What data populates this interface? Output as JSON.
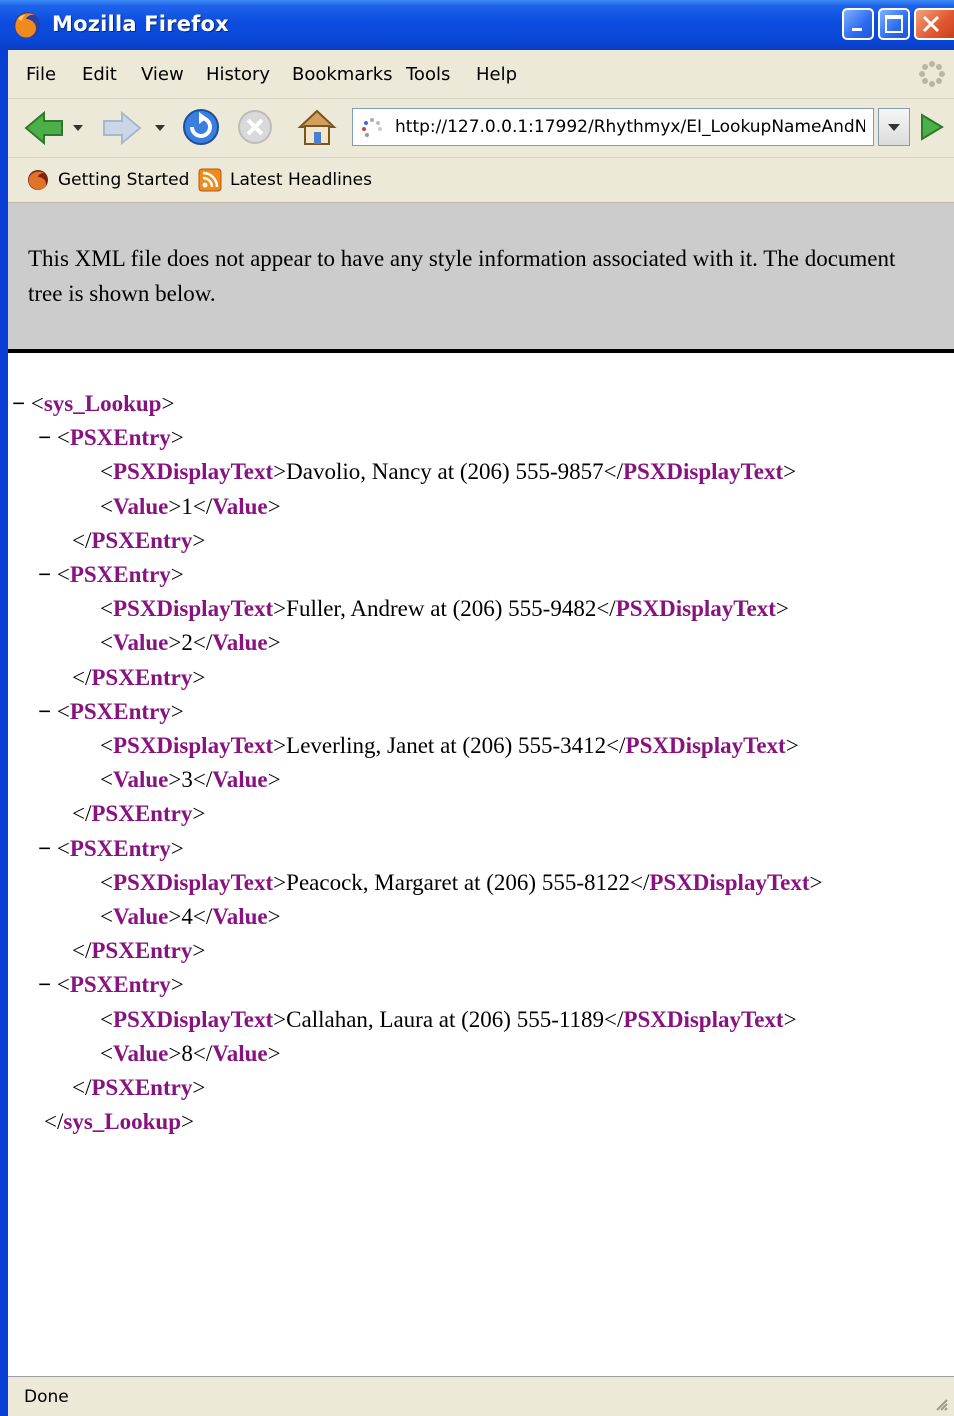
{
  "window": {
    "title": "Mozilla Firefox"
  },
  "menu": [
    "File",
    "Edit",
    "View",
    "History",
    "Bookmarks",
    "Tools",
    "Help"
  ],
  "address": {
    "url": "http://127.0.0.1:17992/Rhythmyx/EI_LookupNameAndNu"
  },
  "bookmarks": [
    "Getting Started",
    "Latest Headlines"
  ],
  "notice": "This XML file does not appear to have any style information associated with it. The document tree is shown below.",
  "xml": {
    "root_tag": "sys_Lookup",
    "entry_tag": "PSXEntry",
    "display_tag": "PSXDisplayText",
    "value_tag": "Value",
    "collapse_symbol": "−",
    "entries": [
      {
        "display": "Davolio, Nancy at (206) 555-9857",
        "value": "1"
      },
      {
        "display": "Fuller, Andrew at (206) 555-9482",
        "value": "2"
      },
      {
        "display": "Leverling, Janet at (206) 555-3412",
        "value": "3"
      },
      {
        "display": "Peacock, Margaret at (206) 555-8122",
        "value": "4"
      },
      {
        "display": "Callahan, Laura at (206) 555-1189",
        "value": "8"
      }
    ]
  },
  "status": "Done",
  "colors": {
    "tag": "#881280",
    "titlebar": "#0a47d6",
    "notice_bg": "#cccccc",
    "chrome": "#ece9d8"
  }
}
